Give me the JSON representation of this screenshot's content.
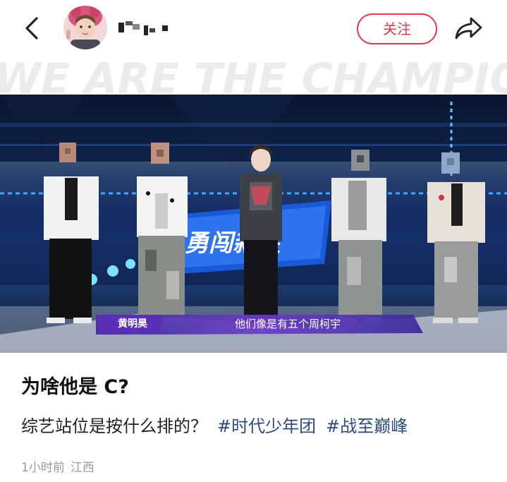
{
  "header": {
    "follow_label": "关注",
    "icons": {
      "back": "chevron-left-icon",
      "share": "share-arrow-icon"
    }
  },
  "media": {
    "watermark_text": "WE ARE THE CHAMPIONS",
    "subtitle": "他们像是有五个周柯宇",
    "name_tag": "黄明昊",
    "stage_logo_text": "勇闯新星"
  },
  "post": {
    "title": "为啥他是 C?",
    "description": "综艺站位是按什么排的？",
    "hashtags": [
      "#时代少年团",
      "#战至巅峰"
    ],
    "time": "1小时前",
    "location": "江西"
  },
  "colors": {
    "accent": "#e0384a",
    "hashtag": "#2d4a7a",
    "meta": "#999999",
    "caption_bar": "#5a2fb8"
  }
}
